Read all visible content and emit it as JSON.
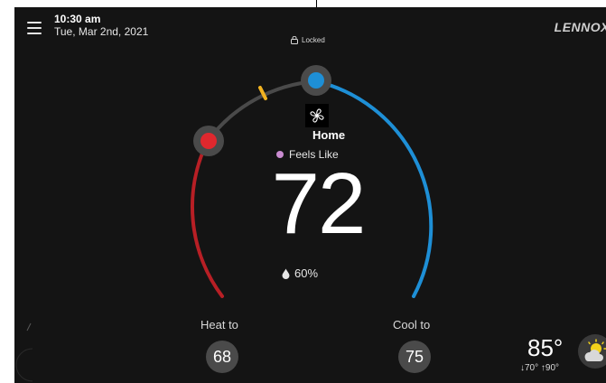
{
  "header": {
    "time": "10:30 am",
    "date": "Tue, Mar 2nd, 2021",
    "lock_label": "Locked",
    "brand": "LENNOX"
  },
  "thermostat": {
    "fan_icon": "fan-icon",
    "mode": "Home",
    "feels_like_label": "Feels Like",
    "temperature": "72",
    "humidity": "60%",
    "heat_label": "Heat to",
    "heat_setpoint": "68",
    "cool_label": "Cool to",
    "cool_setpoint": "75"
  },
  "weather": {
    "temperature": "85°",
    "low_high": "↓70° ↑90°",
    "icon": "partly-sunny-icon"
  },
  "colors": {
    "heat": "#e0282e",
    "cool": "#1e8fd6",
    "marker": "#f2b320",
    "feels_like": "#c98bd0",
    "background": "#141414"
  }
}
